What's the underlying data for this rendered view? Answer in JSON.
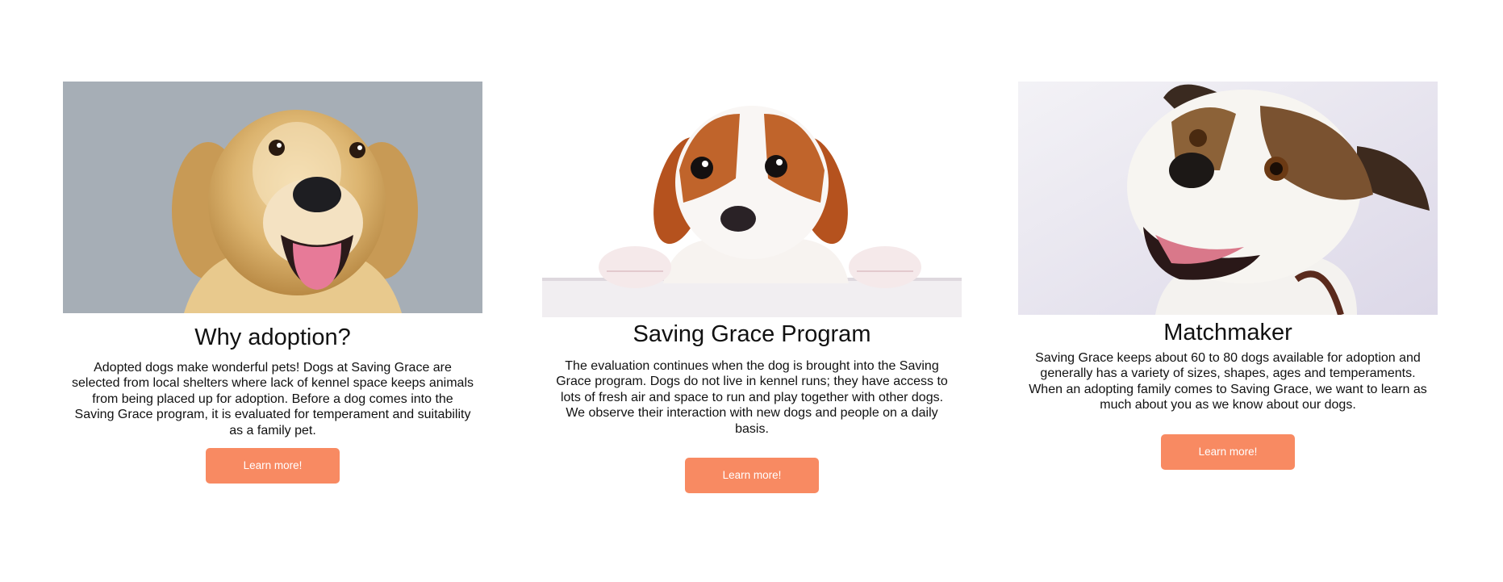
{
  "cards": [
    {
      "image_alt": "golden retriever",
      "title": "Why adoption?",
      "text": "Adopted dogs make wonderful pets! Dogs at Saving Grace are selected from local shelters where lack of kennel space keeps animals from being placed up for adoption. Before a dog comes into the Saving Grace program, it is evaluated for temperament and suitability as a family pet.",
      "button_label": "Learn more!"
    },
    {
      "image_alt": "puppy",
      "title": "Saving Grace Program",
      "text": "The evaluation continues when the dog is brought into the Saving Grace program. Dogs do not live in kennel runs; they have access to lots of fresh air and space to run and play together with other dogs. We observe their interaction with new dogs and people on a daily basis.",
      "button_label": "Learn more!"
    },
    {
      "image_alt": "terrier dog",
      "title": "Matchmaker",
      "text": "Saving Grace keeps about 60 to 80 dogs available for adoption and generally has a variety of sizes, shapes, ages and temperaments. When an adopting family comes to Saving Grace, we want to learn as much about you as we know about our dogs.",
      "button_label": "Learn more!"
    }
  ],
  "colors": {
    "button_bg": "#f88a62",
    "button_text": "#ffffff",
    "text": "#111111",
    "background": "#ffffff"
  }
}
